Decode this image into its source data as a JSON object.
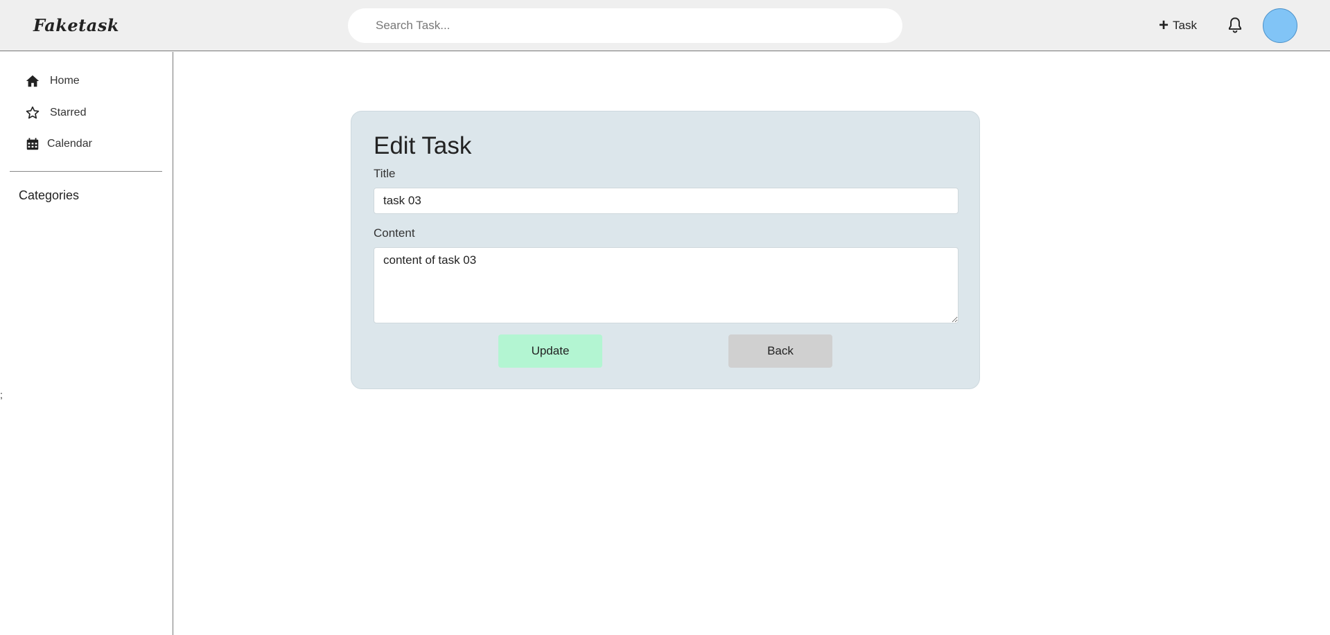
{
  "header": {
    "logo": "Faketask",
    "search_placeholder": "Search Task...",
    "add_task_label": "Task",
    "avatar_color": "#81c4f6"
  },
  "sidebar": {
    "items": [
      {
        "label": "Home",
        "icon": "home-icon"
      },
      {
        "label": "Starred",
        "icon": "star-icon"
      },
      {
        "label": "Calendar",
        "icon": "calendar-icon"
      }
    ],
    "categories_heading": "Categories",
    "stray_text": ";"
  },
  "form": {
    "heading": "Edit Task",
    "title_label": "Title",
    "title_value": "task 03",
    "content_label": "Content",
    "content_value": "content of task 03",
    "update_label": "Update",
    "back_label": "Back"
  },
  "colors": {
    "card_background": "#dce6eb",
    "update_button": "#b3f5d2",
    "back_button": "#d0d0d0",
    "topbar": "#efefef"
  }
}
